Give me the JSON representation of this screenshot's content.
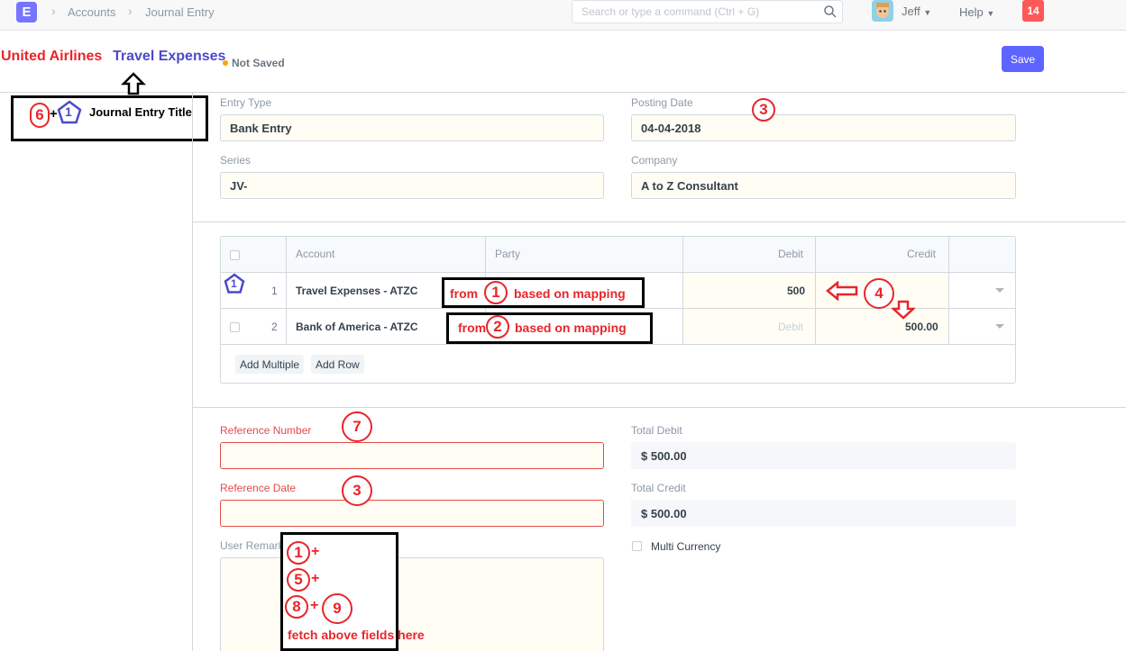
{
  "navbar": {
    "logo": "E",
    "breadcrumbs": [
      "Accounts",
      "Journal Entry"
    ],
    "search_placeholder": "Search or type a command (Ctrl + G)",
    "user": "Jeff",
    "help": "Help",
    "notifications": "14"
  },
  "page": {
    "title_part1": "United Airlines",
    "title_part2": "Travel Expenses",
    "status": "Not Saved",
    "save_label": "Save"
  },
  "form": {
    "entry_type": {
      "label": "Entry Type",
      "value": "Bank Entry"
    },
    "posting_date": {
      "label": "Posting Date",
      "value": "04-04-2018"
    },
    "series": {
      "label": "Series",
      "value": "JV-"
    },
    "company": {
      "label": "Company",
      "value": "A to Z Consultant"
    },
    "reference_number": {
      "label": "Reference Number",
      "value": ""
    },
    "reference_date": {
      "label": "Reference Date",
      "value": ""
    },
    "user_remark": {
      "label": "User Remark",
      "value": ""
    },
    "total_debit": {
      "label": "Total Debit",
      "value": "$ 500.00"
    },
    "total_credit": {
      "label": "Total Credit",
      "value": "$ 500.00"
    },
    "multi_currency": {
      "label": "Multi Currency",
      "checked": false
    }
  },
  "accounts_table": {
    "columns": [
      "Account",
      "Party",
      "Debit",
      "Credit"
    ],
    "rows": [
      {
        "idx": "1",
        "account": "Travel Expenses - ATZC",
        "debit": "500",
        "credit": ""
      },
      {
        "idx": "2",
        "account": "Bank of America - ATZC",
        "debit": "Debit",
        "credit": "500.00"
      }
    ],
    "add_multiple": "Add Multiple",
    "add_row": "Add Row"
  },
  "annotations": {
    "title_note": "Journal Entry Title",
    "title_num_a": "6",
    "plus": "+",
    "pentagon_num": "1",
    "posting_num": "3",
    "row1_from": "from",
    "row1_num": "1",
    "row1_mapping": "based on mapping",
    "row2_from": "from",
    "row2_num": "2",
    "row2_mapping": "based on mapping",
    "credit_num": "4",
    "ref_num_num": "7",
    "ref_date_num": "3",
    "remark_nums": [
      "1",
      "5",
      "8",
      "9"
    ],
    "remark_note": "fetch above fields here"
  },
  "colors": {
    "accent": "#5e64ff",
    "annotation_red": "#e8262b",
    "annotation_blue": "#4b4bc8"
  }
}
